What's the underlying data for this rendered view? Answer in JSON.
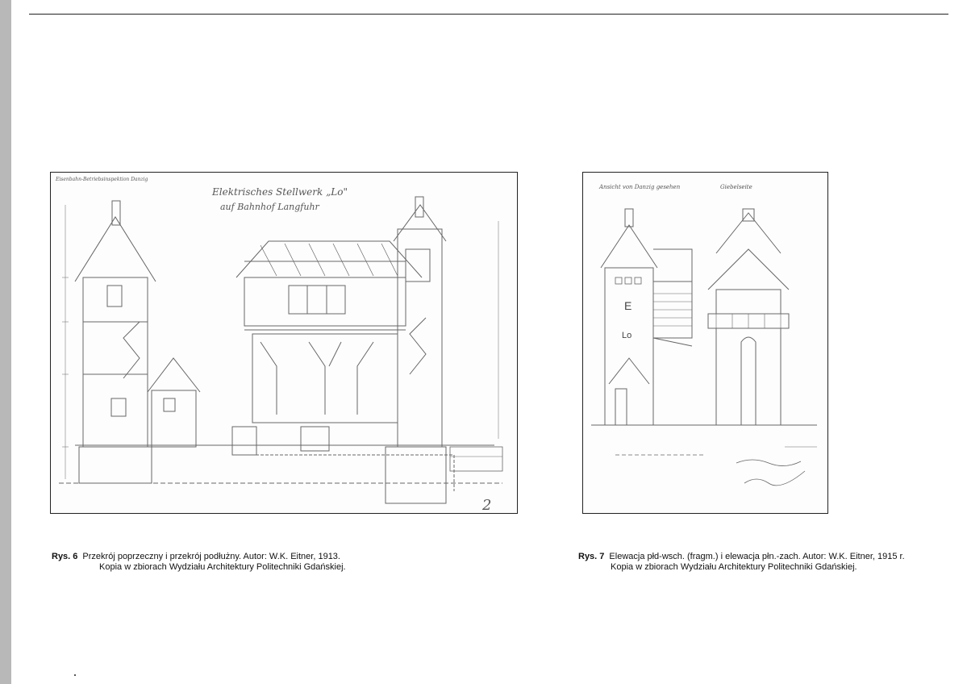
{
  "captions": {
    "fig6": {
      "number": "Rys. 6",
      "line1": "Przekrój poprzeczny i przekrój podłużny. Autor: W.K. Eitner, 1913.",
      "line2": "Kopia w zbiorach Wydziału Architektury Politechniki Gdańskiej."
    },
    "fig7": {
      "number": "Rys. 7",
      "line1": "Elewacja płd-wsch. (fragm.) i elewacja płn.-zach. Autor: W.K. Eitner, 1915 r.",
      "line2": "Kopia w zbiorach Wydziału Architektury Politechniki Gdańskiej."
    }
  },
  "drawing6": {
    "title_line1": "Elektrisches Stellwerk „Lo\"",
    "title_line2": "auf Bahnhof Langfuhr",
    "corner_note": "Eisenbahn-Betriebsinspektion Danzig",
    "sheet_number": "2"
  },
  "drawing7": {
    "label_left": "Ansicht von Danzig gesehen",
    "label_right": "Giebelseite",
    "tower_letters": [
      "E",
      "Lo"
    ]
  }
}
